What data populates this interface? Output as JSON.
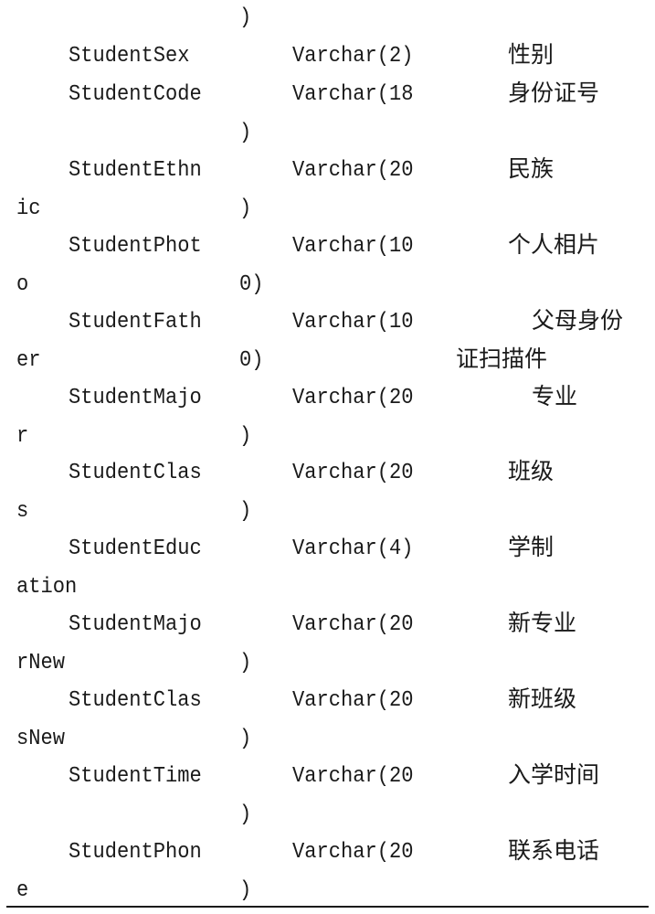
{
  "document": {
    "top_fragment": ")",
    "rows": [
      {
        "field": [
          "StudentSex",
          ""
        ],
        "type": [
          "Varchar(2)",
          ""
        ],
        "desc": [
          "性别",
          ""
        ]
      },
      {
        "field": [
          "StudentCode",
          ""
        ],
        "type": [
          "Varchar(18",
          ")"
        ],
        "desc": [
          "身份证号",
          ""
        ]
      },
      {
        "field": [
          "StudentEthn",
          "ic"
        ],
        "type": [
          "Varchar(20",
          ")"
        ],
        "desc": [
          "民族",
          ""
        ]
      },
      {
        "field": [
          "StudentPhot",
          "o"
        ],
        "type": [
          "Varchar(10",
          "0)"
        ],
        "desc": [
          "个人相片",
          ""
        ]
      },
      {
        "field": [
          "StudentFath",
          "er"
        ],
        "type": [
          "Varchar(10",
          "0)"
        ],
        "desc": [
          "父母身份",
          "证扫描件"
        ]
      },
      {
        "field": [
          "StudentMajo",
          "r"
        ],
        "type": [
          "Varchar(20",
          ")"
        ],
        "desc": [
          "专业",
          ""
        ]
      },
      {
        "field": [
          "StudentClas",
          "s"
        ],
        "type": [
          "Varchar(20",
          ")"
        ],
        "desc": [
          "班级",
          ""
        ]
      },
      {
        "field": [
          "StudentEduc",
          "ation"
        ],
        "type": [
          "Varchar(4)",
          ""
        ],
        "desc": [
          "学制",
          ""
        ]
      },
      {
        "field": [
          "StudentMajo",
          "rNew"
        ],
        "type": [
          "Varchar(20",
          ")"
        ],
        "desc": [
          "新专业",
          ""
        ]
      },
      {
        "field": [
          "StudentClas",
          "sNew"
        ],
        "type": [
          "Varchar(20",
          ")"
        ],
        "desc": [
          "新班级",
          ""
        ]
      },
      {
        "field": [
          "StudentTime",
          ""
        ],
        "type": [
          "Varchar(20",
          ")"
        ],
        "desc": [
          "入学时间",
          ""
        ]
      },
      {
        "field": [
          "StudentPhon",
          "e"
        ],
        "type": [
          "Varchar(20",
          ")"
        ],
        "desc": [
          "联系电话",
          ""
        ]
      }
    ]
  }
}
